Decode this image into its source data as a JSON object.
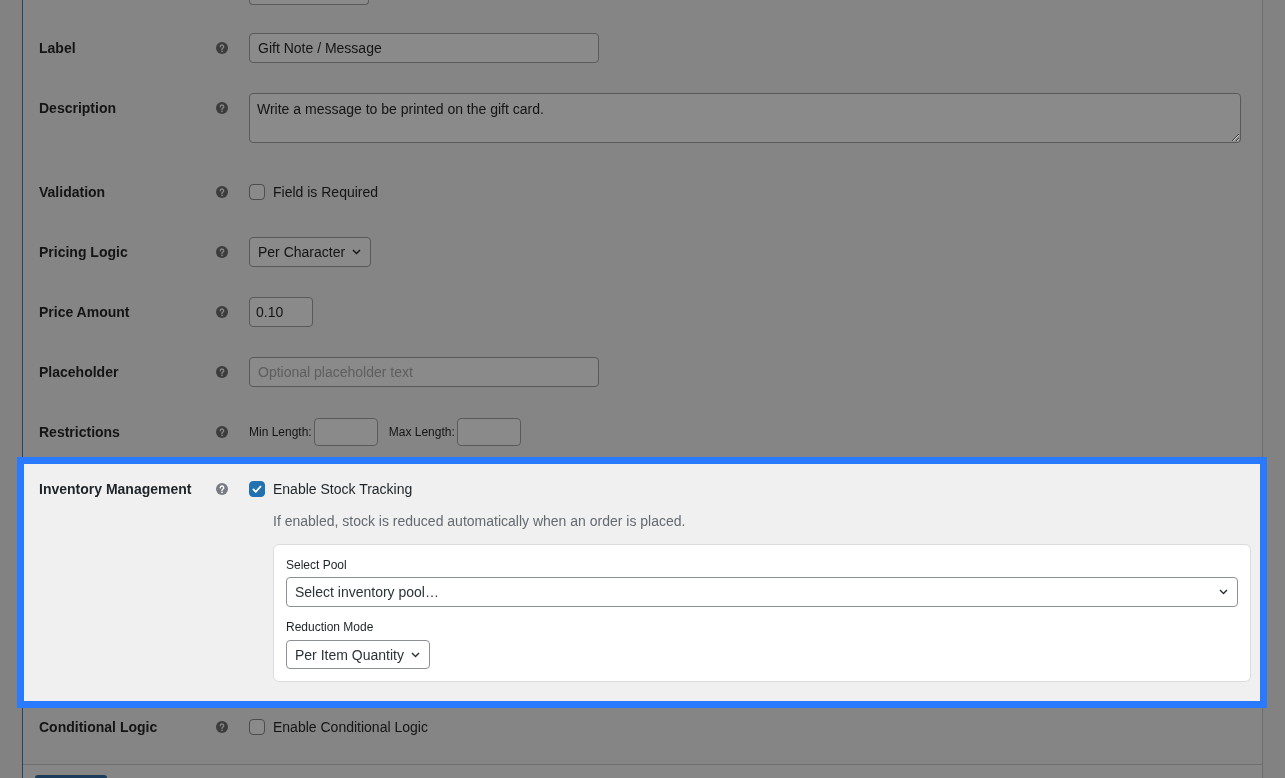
{
  "form": {
    "clipped_field": {
      "kind": "input"
    },
    "rows": [
      {
        "kind": "text",
        "label": "Label",
        "help": true,
        "highlighted": false,
        "value": "Gift Note / Message"
      },
      {
        "kind": "textarea",
        "label": "Description",
        "help": true,
        "highlighted": false,
        "value": "Write a message to be printed on the gift card."
      },
      {
        "kind": "checkbox",
        "label": "Validation",
        "help": true,
        "highlighted": false,
        "option": "Field is Required",
        "checked": false
      },
      {
        "kind": "select",
        "label": "Pricing Logic",
        "help": true,
        "highlighted": false,
        "value": "Per Character"
      },
      {
        "kind": "number",
        "label": "Price Amount",
        "help": true,
        "highlighted": false,
        "value": "0.10"
      },
      {
        "kind": "text",
        "label": "Placeholder",
        "help": true,
        "highlighted": false,
        "placeholder": "Optional placeholder text"
      },
      {
        "kind": "range",
        "label": "Restrictions",
        "help": true,
        "highlighted": false,
        "min_label": "Min Length:",
        "max_label": "Max Length:"
      },
      {
        "kind": "checkbox",
        "label": "Inventory Management",
        "help": true,
        "highlighted": true,
        "option": "Enable Stock Tracking",
        "checked": true,
        "hint": "If enabled, stock is reduced automatically when an order is placed.",
        "settings": [
          {
            "kind": "wide",
            "label": "Select Pool",
            "value": "Select inventory pool…"
          },
          {
            "kind": "compact",
            "label": "Reduction Mode",
            "value": "Per Item Quantity"
          }
        ]
      },
      {
        "kind": "checkbox",
        "label": "Conditional Logic",
        "help": true,
        "highlighted": false,
        "option": "Enable Conditional Logic",
        "checked": false
      }
    ],
    "footer": {
      "button": {
        "kind": "primary"
      }
    }
  }
}
